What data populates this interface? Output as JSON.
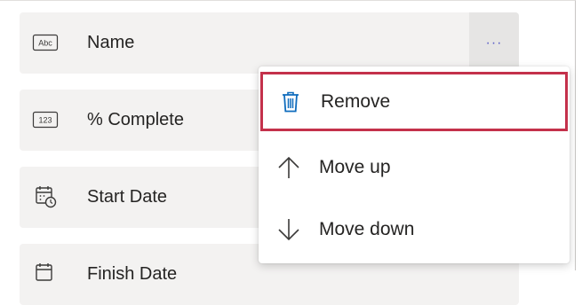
{
  "fields": [
    {
      "label": "Name",
      "icon": "text-field-icon",
      "icon_text": "Abc"
    },
    {
      "label": "% Complete",
      "icon": "number-field-icon",
      "icon_text": "123"
    },
    {
      "label": "Start Date",
      "icon": "calendar-clock-icon"
    },
    {
      "label": "Finish Date",
      "icon": "calendar-clock-icon"
    }
  ],
  "more_button": {
    "label": "···"
  },
  "context_menu": {
    "items": [
      {
        "label": "Remove",
        "icon": "trash-icon"
      },
      {
        "label": "Move up",
        "icon": "arrow-up-icon"
      },
      {
        "label": "Move down",
        "icon": "arrow-down-icon"
      }
    ]
  },
  "colors": {
    "accent": "#0f6cbd",
    "highlight_border": "#c4314b",
    "more_dots": "#5b5fc7"
  }
}
